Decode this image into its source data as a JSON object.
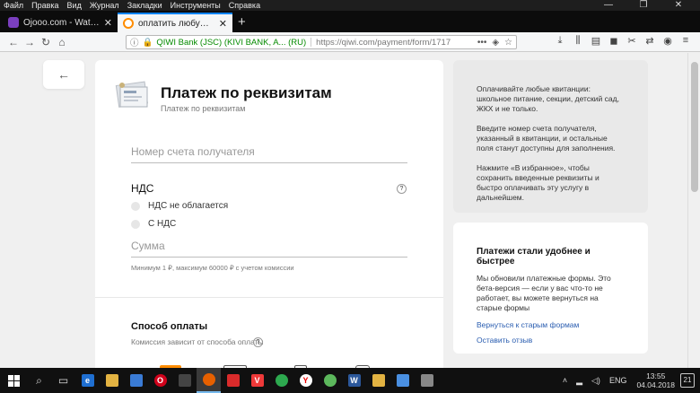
{
  "menubar": {
    "items": [
      "Файл",
      "Правка",
      "Вид",
      "Журнал",
      "Закладки",
      "Инструменты",
      "Справка"
    ]
  },
  "window_controls": [
    "—",
    "❐",
    "✕"
  ],
  "tabs": [
    {
      "title": "Ojooo.com - Watching Ad - Pa",
      "favicon_color": "#7b3fbf",
      "active": false
    },
    {
      "title": "оплатить любую квитанцию с",
      "favicon_color": "#ff8c00",
      "active": true
    }
  ],
  "navbar": {
    "identity": "QIWI Bank (JSC) (KIVI BANK, A... (RU)",
    "url": "https://qiwi.com/payment/form/1717",
    "reader_glyph": "•••"
  },
  "page": {
    "title": "Платеж по реквизитам",
    "subtitle": "Платеж по реквизитам",
    "account_placeholder": "Номер счета получателя",
    "nds_label": "НДС",
    "nds_options": [
      "НДС не облагается",
      "С НДС"
    ],
    "sum_placeholder": "Сумма",
    "sum_hint": "Минимум 1 ₽, максимум 60000 ₽ с учетом комиссии",
    "payment_method_title": "Способ оплаты",
    "payment_method_sub": "Комиссия зависит от способа оплаты"
  },
  "info_panel": {
    "p1": "Оплачивайте любые квитанции: школьное питание, секции, детский сад, ЖКХ и не только.",
    "p2": "Введите номер счета получателя, указанный в квитанции, и остальные поля станут доступны для заполнения.",
    "p3": "Нажмите «В избранное», чтобы сохранить введенные реквизиты и быстро оплачивать эту услугу в дальнейшем."
  },
  "beta_panel": {
    "heading": "Платежи стали удобнее и быстрее",
    "text": "Мы обновили платежные формы. Это бета-версия — если у вас что-то не работает, вы можете вернуться на старые формы",
    "link_old": "Вернуться к старым формам",
    "link_feedback": "Оставить отзыв"
  },
  "taskbar": {
    "lang": "ENG",
    "time": "13:55",
    "date": "04.04.2018",
    "notifications": "21"
  },
  "colors": {
    "accent_blue": "#0a84ff",
    "secure_green": "#058b00",
    "qiwi_orange": "#ff8c00",
    "link_blue": "#2a5db0"
  }
}
